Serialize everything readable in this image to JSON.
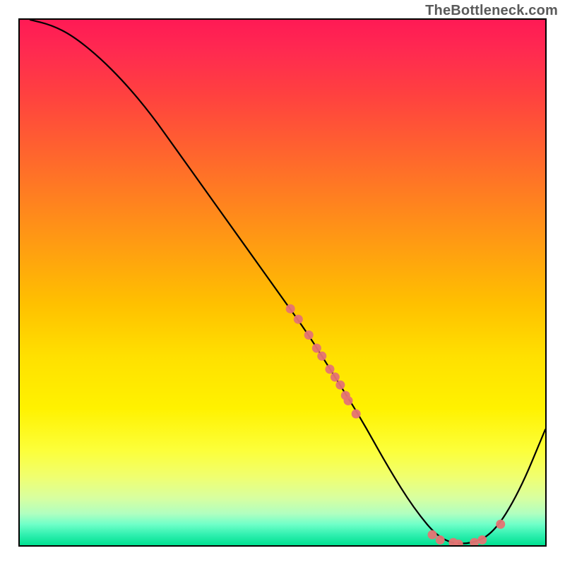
{
  "watermark": "TheBottleneck.com",
  "chart_data": {
    "type": "line",
    "title": "",
    "xlabel": "",
    "ylabel": "",
    "xlim": [
      0,
      100
    ],
    "ylim": [
      0,
      100
    ],
    "curve": {
      "x": [
        2,
        6,
        10,
        15,
        20,
        25,
        30,
        35,
        40,
        45,
        50,
        55,
        60,
        65,
        70,
        75,
        80,
        85,
        90,
        95,
        100
      ],
      "y": [
        100,
        99,
        97,
        93,
        88,
        82,
        75,
        68,
        61,
        54,
        47,
        40,
        32,
        24,
        15,
        7,
        1,
        0,
        2,
        10,
        22
      ]
    },
    "points": [
      {
        "x": 51.5,
        "y": 45.0
      },
      {
        "x": 53.0,
        "y": 43.0
      },
      {
        "x": 55.0,
        "y": 40.0
      },
      {
        "x": 56.5,
        "y": 37.5
      },
      {
        "x": 57.5,
        "y": 36.0
      },
      {
        "x": 59.0,
        "y": 33.5
      },
      {
        "x": 60.0,
        "y": 32.0
      },
      {
        "x": 61.0,
        "y": 30.5
      },
      {
        "x": 62.0,
        "y": 28.5
      },
      {
        "x": 62.5,
        "y": 27.5
      },
      {
        "x": 64.0,
        "y": 25.0
      },
      {
        "x": 78.5,
        "y": 2.0
      },
      {
        "x": 80.0,
        "y": 1.0
      },
      {
        "x": 82.5,
        "y": 0.5
      },
      {
        "x": 83.5,
        "y": 0.2
      },
      {
        "x": 86.5,
        "y": 0.5
      },
      {
        "x": 88.0,
        "y": 1.0
      },
      {
        "x": 91.5,
        "y": 4.0
      }
    ],
    "point_color": "#e57373",
    "curve_color": "#000000"
  }
}
